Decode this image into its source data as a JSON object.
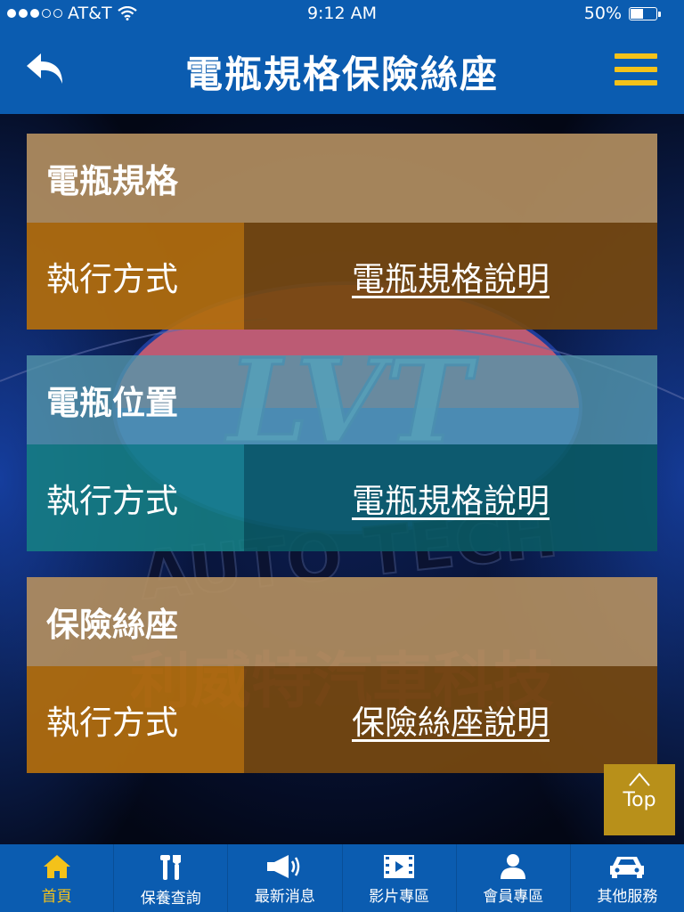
{
  "status_bar": {
    "carrier": "AT&T",
    "time": "9:12 AM",
    "battery_text": "50%",
    "battery_level": 0.5,
    "signal_bars": 3,
    "signal_total": 5
  },
  "nav": {
    "title": "電瓶規格保險絲座",
    "back_icon": "back-arrow-icon",
    "menu_icon": "hamburger-menu-icon"
  },
  "background_logo": {
    "brand": "LVT",
    "tagline": "AUTO TECH",
    "company": "利威特汽車科技"
  },
  "cards": [
    {
      "title": "電瓶規格",
      "row_label": "執行方式",
      "link_text": "電瓶規格說明"
    },
    {
      "title": "電瓶位置",
      "row_label": "執行方式",
      "link_text": "電瓶規格說明"
    },
    {
      "title": "保險絲座",
      "row_label": "執行方式",
      "link_text": "保險絲座說明"
    }
  ],
  "top_button": {
    "label": "Top",
    "icon": "caret-up-icon"
  },
  "tabs": [
    {
      "label": "首頁",
      "icon": "home-icon",
      "active": true
    },
    {
      "label": "保養查詢",
      "icon": "tools-icon",
      "active": false
    },
    {
      "label": "最新消息",
      "icon": "megaphone-icon",
      "active": false
    },
    {
      "label": "影片專區",
      "icon": "video-icon",
      "active": false
    },
    {
      "label": "會員專區",
      "icon": "user-icon",
      "active": false
    },
    {
      "label": "其他服務",
      "icon": "car-icon",
      "active": false
    }
  ],
  "colors": {
    "bar_blue": "#0b5cb0",
    "accent_yellow": "#f4c21a",
    "top_button": "#b8901a"
  }
}
